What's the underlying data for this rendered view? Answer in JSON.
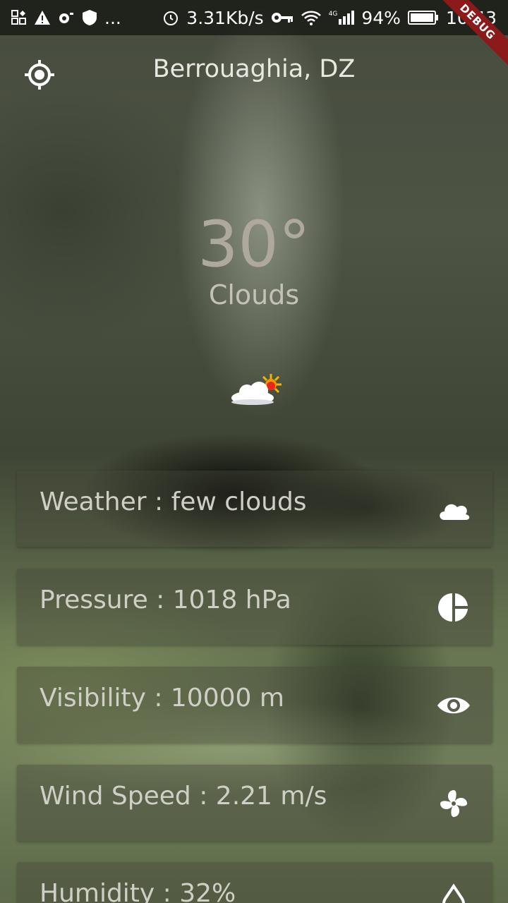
{
  "status_bar": {
    "network_speed": "3.31Kb/s",
    "battery": "94%",
    "time": "10:43",
    "ellipsis": "...",
    "cellular_type": "4G"
  },
  "debug_banner": "DEBUG",
  "header": {
    "location": "Berrouaghia, DZ"
  },
  "current": {
    "temperature": "30°",
    "condition": "Clouds",
    "icon": "few-clouds-icon"
  },
  "details": [
    {
      "label": "Weather : few clouds",
      "icon": "cloud-icon"
    },
    {
      "label": "Pressure : 1018 hPa",
      "icon": "pie-chart-icon"
    },
    {
      "label": "Visibility : 10000 m",
      "icon": "eye-icon"
    },
    {
      "label": "Wind Speed : 2.21 m/s",
      "icon": "fan-icon"
    },
    {
      "label": "Humidity : 32%",
      "icon": "water-drop-icon"
    }
  ]
}
